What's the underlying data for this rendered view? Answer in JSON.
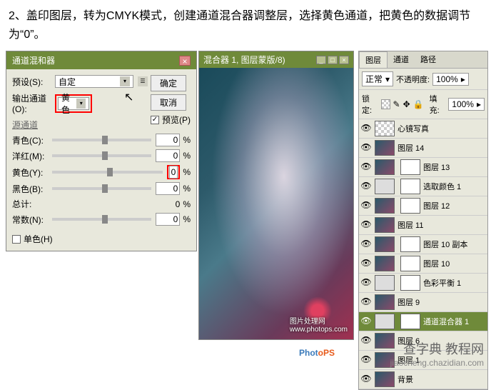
{
  "instruction": "2、盖印图层，转为CMYK模式，创建通道混合器调整层，选择黄色通道，把黄色的数据调节为“0”。",
  "mixer": {
    "title": "通道混和器",
    "preset_label": "预设(S):",
    "preset_value": "自定",
    "output_label": "输出通道(O):",
    "output_value": "黄色",
    "section": "源通道",
    "cyan_label": "青色(C):",
    "cyan_value": "0",
    "magenta_label": "洋红(M):",
    "magenta_value": "0",
    "yellow_label": "黄色(Y):",
    "yellow_value": "0",
    "black_label": "黑色(B):",
    "black_value": "0",
    "total_label": "总计:",
    "total_value": "0",
    "constant_label": "常数(N):",
    "constant_value": "0",
    "mono_label": "单色(H)",
    "ok": "确定",
    "cancel": "取消",
    "preview": "预览(P)",
    "pct": "%"
  },
  "doc": {
    "title": "混合器 1, 图层蒙版/8)",
    "photops_url": "www.photops.com",
    "photops_label": "图片处理网"
  },
  "layers": {
    "tab1": "图层",
    "tab2": "通道",
    "tab3": "路径",
    "mode": "正常",
    "opacity_label": "不透明度:",
    "opacity_value": "100%",
    "lock_label": "锁定:",
    "fill_label": "填充:",
    "fill_value": "100%",
    "items": [
      {
        "name": "心镜写真",
        "thumb": "checker"
      },
      {
        "name": "图层 14",
        "thumb": "img"
      },
      {
        "name": "图层 13",
        "thumb": "img",
        "mask": true
      },
      {
        "name": "选取颜色 1",
        "thumb": "adj",
        "mask": true
      },
      {
        "name": "图层 12",
        "thumb": "img",
        "mask": true
      },
      {
        "name": "图层 11",
        "thumb": "img"
      },
      {
        "name": "图层 10 副本",
        "thumb": "img",
        "mask": true
      },
      {
        "name": "图层 10",
        "thumb": "img",
        "mask": true
      },
      {
        "name": "色彩平衡 1",
        "thumb": "adj",
        "mask": true
      },
      {
        "name": "图层 9",
        "thumb": "img"
      },
      {
        "name": "通道混合器 1",
        "thumb": "adj",
        "mask": true,
        "selected": true
      },
      {
        "name": "图层 6",
        "thumb": "img"
      },
      {
        "name": "图层 1",
        "thumb": "img"
      },
      {
        "name": "背景",
        "thumb": "img"
      }
    ]
  },
  "watermark": {
    "line1": "查字典 教程网",
    "line2": "jiaocheng.chazidian.com"
  },
  "photops": {
    "p1": "Phot",
    "p2": "oPS"
  }
}
